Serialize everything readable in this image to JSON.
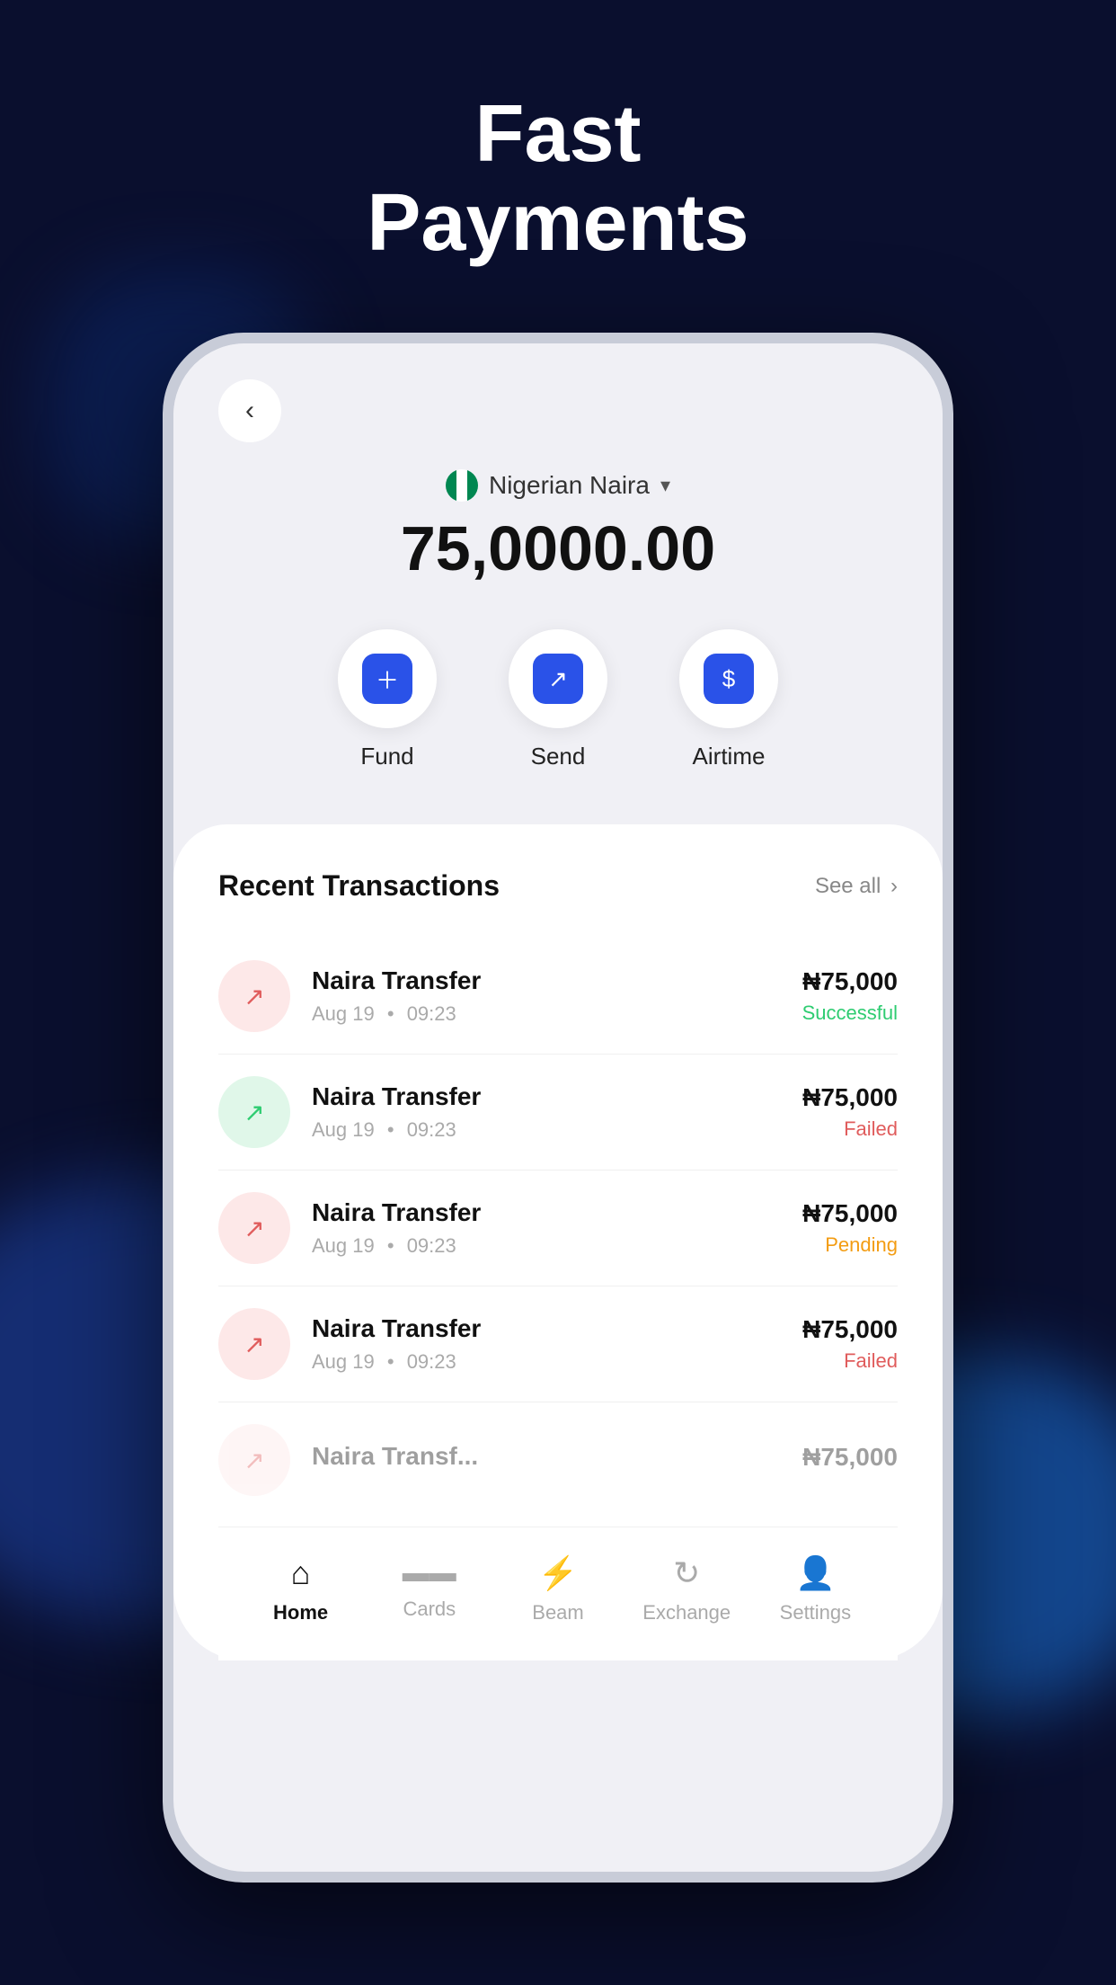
{
  "hero": {
    "line1": "Fast",
    "line2": "Payments"
  },
  "phone": {
    "currency": {
      "name": "Nigerian Naira",
      "flag": "NG"
    },
    "balance": "75,0000.00",
    "actions": [
      {
        "id": "fund",
        "label": "Fund",
        "icon": "+"
      },
      {
        "id": "send",
        "label": "Send",
        "icon": "↗"
      },
      {
        "id": "airtime",
        "label": "Airtime",
        "icon": "$"
      }
    ],
    "transactions": {
      "title": "Recent Transactions",
      "see_all": "See all",
      "items": [
        {
          "name": "Naira Transfer",
          "date": "Aug 19",
          "time": "09:23",
          "amount": "₦75,000",
          "status": "Successful",
          "status_class": "successful",
          "icon_color": "pink",
          "arrow_color": "red"
        },
        {
          "name": "Naira Transfer",
          "date": "Aug 19",
          "time": "09:23",
          "amount": "₦75,000",
          "status": "Failed",
          "status_class": "failed",
          "icon_color": "green",
          "arrow_color": "green"
        },
        {
          "name": "Naira Transfer",
          "date": "Aug 19",
          "time": "09:23",
          "amount": "₦75,000",
          "status": "Pending",
          "status_class": "pending",
          "icon_color": "pink",
          "arrow_color": "red"
        },
        {
          "name": "Naira Transfer",
          "date": "Aug 19",
          "time": "09:23",
          "amount": "₦75,000",
          "status": "Failed",
          "status_class": "failed",
          "icon_color": "pink",
          "arrow_color": "red"
        }
      ]
    },
    "nav": [
      {
        "id": "home",
        "label": "Home",
        "icon": "🏠",
        "active": true
      },
      {
        "id": "cards",
        "label": "Cards",
        "icon": "💳",
        "active": false
      },
      {
        "id": "beam",
        "label": "Beam",
        "icon": "⚡",
        "active": false
      },
      {
        "id": "exchange",
        "label": "Exchange",
        "icon": "🔄",
        "active": false
      },
      {
        "id": "settings",
        "label": "Settings",
        "icon": "👤",
        "active": false
      }
    ]
  }
}
